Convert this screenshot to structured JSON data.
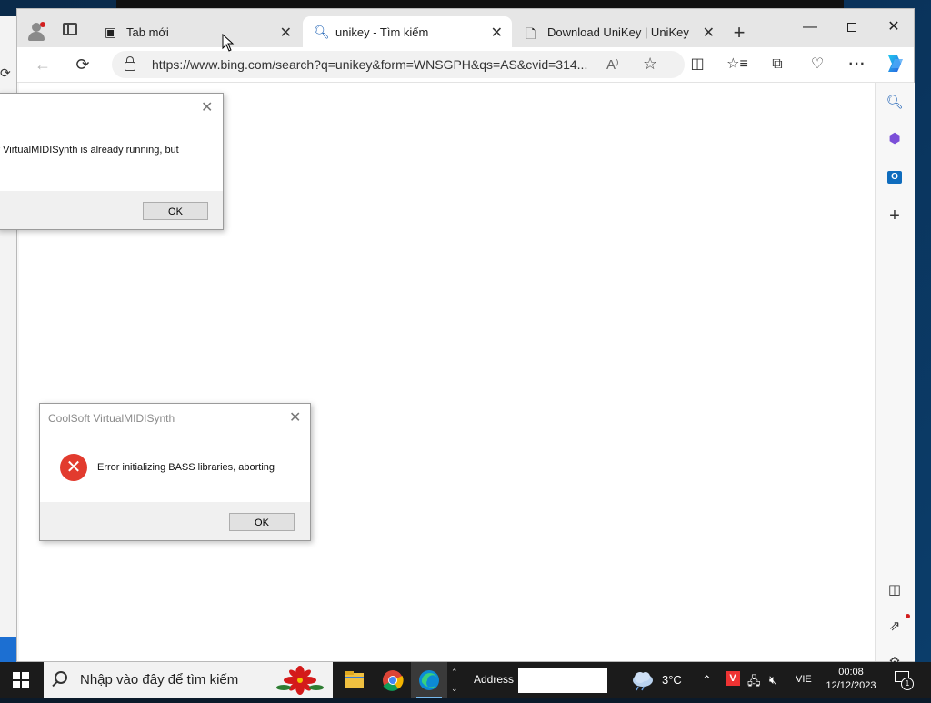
{
  "browser": {
    "tabs": [
      {
        "label": "Tab mới",
        "icon": "new-tab-page-icon",
        "active": false
      },
      {
        "label": "unikey - Tìm kiếm",
        "icon": "search-icon",
        "active": true
      },
      {
        "label": "Download UniKey | UniKey",
        "icon": "page-icon",
        "active": false
      }
    ],
    "url": "https://www.bing.com/search?q=unikey&form=WNSGPH&qs=AS&cvid=314..."
  },
  "dialog_partial": {
    "message": "f VirtualMIDISynth is already running, but",
    "ok_label": "OK"
  },
  "dialog_error": {
    "title": "CoolSoft VirtualMIDISynth",
    "message": "Error initializing BASS libraries, aborting",
    "ok_label": "OK"
  },
  "taskbar": {
    "search_placeholder": "Nhập vào đây để tìm kiếm",
    "address_label": "Address",
    "temperature": "3°C",
    "language": "VIE",
    "time": "00:08",
    "date": "12/12/2023",
    "notification_count": "1"
  },
  "colors": {
    "error_red": "#e23b2e",
    "taskbar_bg": "#1b1b1b",
    "edge_accent": "#0f6cbd"
  }
}
